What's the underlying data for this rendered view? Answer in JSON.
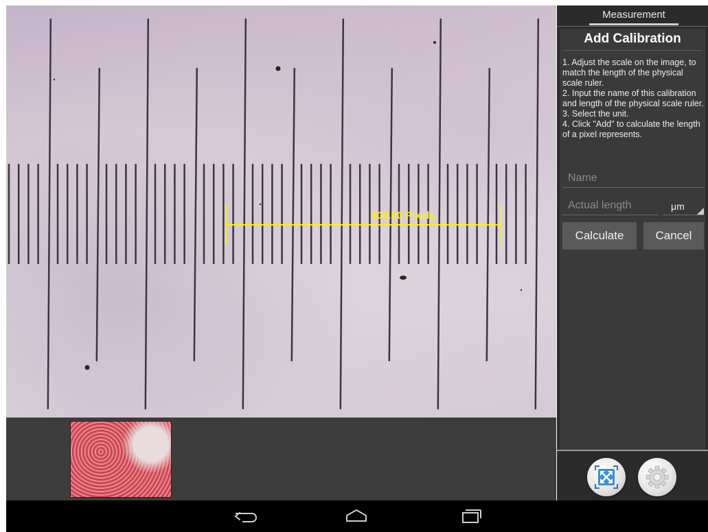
{
  "viewport": {
    "measurement_label": "400.00 Pixels"
  },
  "panel": {
    "tab_label": "Measurement",
    "title": "Add Calibration",
    "instructions": [
      "1. Adjust the scale on the image, to match the length of the physical scale ruler.",
      " 2. Input the name of this calibration and length of the physical scale ruler.",
      " 3. Select the unit.",
      " 4. Click \"Add\" to calculate the length of a pixel represents."
    ],
    "name_placeholder": "Name",
    "length_placeholder": "Actual length",
    "unit_value": "μm",
    "calculate_label": "Calculate",
    "cancel_label": "Cancel"
  },
  "icons": {
    "fit": "fit-screen-icon",
    "settings": "gear-icon",
    "back": "back-icon",
    "home": "home-icon",
    "recents": "recent-apps-icon"
  },
  "colors": {
    "measurement_line": "#fff200",
    "panel_background": "#3a3a3a",
    "button_background": "#5a5a5a"
  }
}
